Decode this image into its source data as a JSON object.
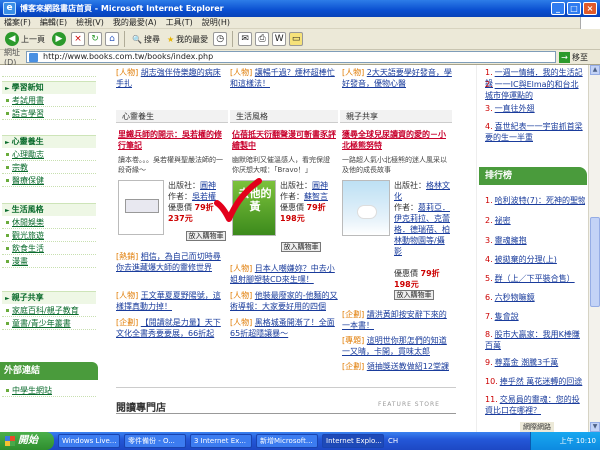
{
  "window": {
    "title": "博客來網路書店首頁 - Microsoft Internet Explorer",
    "min_label": "_",
    "max_label": "□",
    "close_label": "×"
  },
  "menu": [
    "檔案(F)",
    "編輯(E)",
    "檢視(V)",
    "我的最愛(A)",
    "工具(T)",
    "說明(H)"
  ],
  "toolbar": {
    "back_label": "上一頁",
    "search_label": "搜尋",
    "favorites_label": "我的最愛",
    "back_icon": "◀",
    "forward_icon": "▶",
    "stop_icon": "×",
    "refresh_icon": "↻",
    "home_icon": "⌂",
    "search_icon": "🔍",
    "favorites_icon": "★",
    "history_icon": "◷",
    "mail_icon": "✉",
    "print_icon": "⎙",
    "edit_icon": "W",
    "folder_icon": "▭"
  },
  "address": {
    "label": "網址(D)",
    "url": "http://www.books.com.tw/books/index.php",
    "go_label": "移至",
    "go_icon": "→"
  },
  "left_sidebar": {
    "sections": [
      {
        "title": "學習新知",
        "items": [
          "考試用書",
          "語言學習"
        ]
      },
      {
        "title": "心靈養生",
        "items": [
          "心理勵志",
          "宗教",
          "醫療保健"
        ]
      },
      {
        "title": "生活風格",
        "items": [
          "休閒娛樂",
          "觀光旅遊",
          "飲食生活",
          "漫畫"
        ]
      },
      {
        "title": "親子共享",
        "items": [
          "家庭百科/親子教育",
          "童書/青少年叢書"
        ]
      }
    ],
    "external": {
      "title": "外部連結",
      "items": [
        "中學生網站"
      ]
    }
  },
  "center": {
    "top_links": [
      {
        "tag": "[人物]",
        "text": "胡志強伴侍樂趣的病床手扎"
      },
      {
        "tag": "[人物]",
        "text": "讓暢千過？煙杯超棒忙和這樣法！"
      },
      {
        "tag": "[人物]",
        "text": "2大天語要學好發音，學好發音，優物心醫"
      }
    ],
    "columns": [
      {
        "header": "心靈養生",
        "title": "里鐵兵師的開示：吳若權的修行筆記",
        "desc": "讀本卷。。。吳若權與聖嚴法師的一段奇緣～",
        "publisher_label": "出版社",
        "publisher": "圓神",
        "author_label": "作者",
        "author": "吳若權",
        "discount_label": "優惠價",
        "discount": "79折",
        "price": "237元",
        "buy": "放入購物車"
      },
      {
        "header": "生活風格",
        "title": "佔蓓抵天衍翻聲漫可斬書豕評繪製中",
        "desc": "幽默暗利又催溫感人，看完保證你厌想大喊：「Bravo！」",
        "cover_text": "去他的黃",
        "publisher_label": "出版社",
        "publisher": "圓神",
        "author_label": "作者",
        "author": "蘇智言",
        "discount_label": "優惠價",
        "discount": "79折",
        "price": "198元",
        "buy": "放入購物車"
      },
      {
        "header": "親子共享",
        "title": "獲尋全球兒尿讀資的愛的－小北極熊努特",
        "desc": "一路超人氣小北極熊的迷人風采以及他的成長故事",
        "publisher_label": "出版社",
        "publisher": "格林文化",
        "author_label": "作者",
        "author": "葛莉亞．伊克莉拉、克蕾格．德瑞蓓、柏林動物園等/攝影",
        "discount_label": "優惠價",
        "discount": "79折",
        "price": "198元",
        "buy": "放入購物車"
      }
    ],
    "bottom_links": [
      [
        {
          "tag": "[熱銷]",
          "text": "相信，為自己而切時尋你去進藏爆大師的靈修世界"
        },
        {
          "tag": "[人物]",
          "text": "日本人嘲嫌妳？中去小姐射腳塑裝CD來生嘿！"
        },
        {
          "tag": "[企劃]",
          "text": "讀洪黃卸按安辭下來的一本書！"
        }
      ],
      [
        {
          "tag": "[人物]",
          "text": "王文華夏夏野陽號，這樣擇真動力掉！"
        },
        {
          "tag": "[人物]",
          "text": "他裝最廢家的-他麵的又術導報：大家要好用的四個"
        },
        {
          "tag": "[專題]",
          "text": "這明世你那怎們的知道一又晴，卡開，貫味太郎"
        }
      ],
      [
        {
          "tag": "[企劃]",
          "text": "【閱讀就是力量】天下文化全書秀要要展，66折起"
        },
        {
          "tag": "[人物]",
          "text": "黑格城蚤開漸了！全面65折超隱讓暴～"
        },
        {
          "tag": "[企劃]",
          "text": "領抽獎送教做紹12堂課"
        }
      ]
    ],
    "reading_title": "閱讀專門店",
    "feature_label": "FEATURE STORE"
  },
  "right_sidebar": {
    "top_items": [
      {
        "num": "1.",
        "text": "一週一情緒．我的生活記錄"
      },
      {
        "num": "2.",
        "text": "一一IC與Elma的和台北城市停運點的"
      },
      {
        "num": "3.",
        "text": "一直往外翅"
      },
      {
        "num": "4.",
        "text": "喜世紀表一一宇宙抓首梁要的生一半重"
      }
    ],
    "rank_title": "排行榜",
    "ranks": [
      {
        "num": "1.",
        "text": "哈利波特(7)：死神的聖物"
      },
      {
        "num": "2.",
        "text": "祕密"
      },
      {
        "num": "3.",
        "text": "靈魂擁抱"
      },
      {
        "num": "4.",
        "text": "被拋棄的分理(上)"
      },
      {
        "num": "5.",
        "text": "群（上／下平裝合售）"
      },
      {
        "num": "6.",
        "text": "六秒物嘛鏡"
      },
      {
        "num": "7.",
        "text": "隻會說"
      },
      {
        "num": "8.",
        "text": "股市大贏家：我用K棒賺百萬"
      },
      {
        "num": "9.",
        "text": "尊嘉金 潮騰3千萬"
      },
      {
        "num": "10.",
        "text": "捧乎然 萬花迷轉的回途"
      },
      {
        "num": "11.",
        "text": "交易員的靈魂：您的投資比口在哪裡？"
      }
    ]
  },
  "taskbar": {
    "start": "開始",
    "tasks": [
      "Windows Live...",
      "零件備份 - O...",
      "3 Internet Ex...",
      "新增Microsoft...",
      "Internet Explo..."
    ],
    "tray_lang": "CH",
    "time": "上午 10:10",
    "status_zone": "網際網路"
  }
}
